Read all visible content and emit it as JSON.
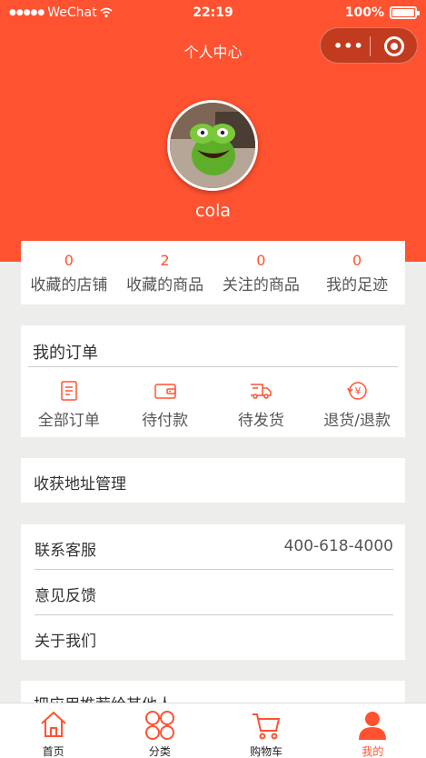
{
  "status_bar": {
    "carrier": "WeChat",
    "time": "22:19",
    "battery": "100%"
  },
  "nav": {
    "title": "个人中心"
  },
  "profile": {
    "username": "cola"
  },
  "stats": [
    {
      "count": "0",
      "label": "收藏的店铺"
    },
    {
      "count": "2",
      "label": "收藏的商品"
    },
    {
      "count": "0",
      "label": "关注的商品"
    },
    {
      "count": "0",
      "label": "我的足迹"
    }
  ],
  "orders": {
    "title": "我的订单",
    "items": [
      {
        "label": "全部订单",
        "icon": "order-list-icon"
      },
      {
        "label": "待付款",
        "icon": "wallet-icon"
      },
      {
        "label": "待发货",
        "icon": "delivery-truck-icon"
      },
      {
        "label": "退货/退款",
        "icon": "refund-icon"
      }
    ]
  },
  "address": {
    "label": "收获地址管理"
  },
  "service": {
    "contact_label": "联系客服",
    "contact_phone": "400-618-4000",
    "feedback_label": "意见反馈",
    "about_label": "关于我们"
  },
  "recommend": {
    "label": "把应用推荐给其他人"
  },
  "tabbar": [
    {
      "label": "首页",
      "icon": "home-icon",
      "active": false
    },
    {
      "label": "分类",
      "icon": "category-icon",
      "active": false
    },
    {
      "label": "购物车",
      "icon": "cart-icon",
      "active": false
    },
    {
      "label": "我的",
      "icon": "user-icon",
      "active": true
    }
  ],
  "colors": {
    "accent": "#ff5230",
    "background": "#ededeb"
  }
}
